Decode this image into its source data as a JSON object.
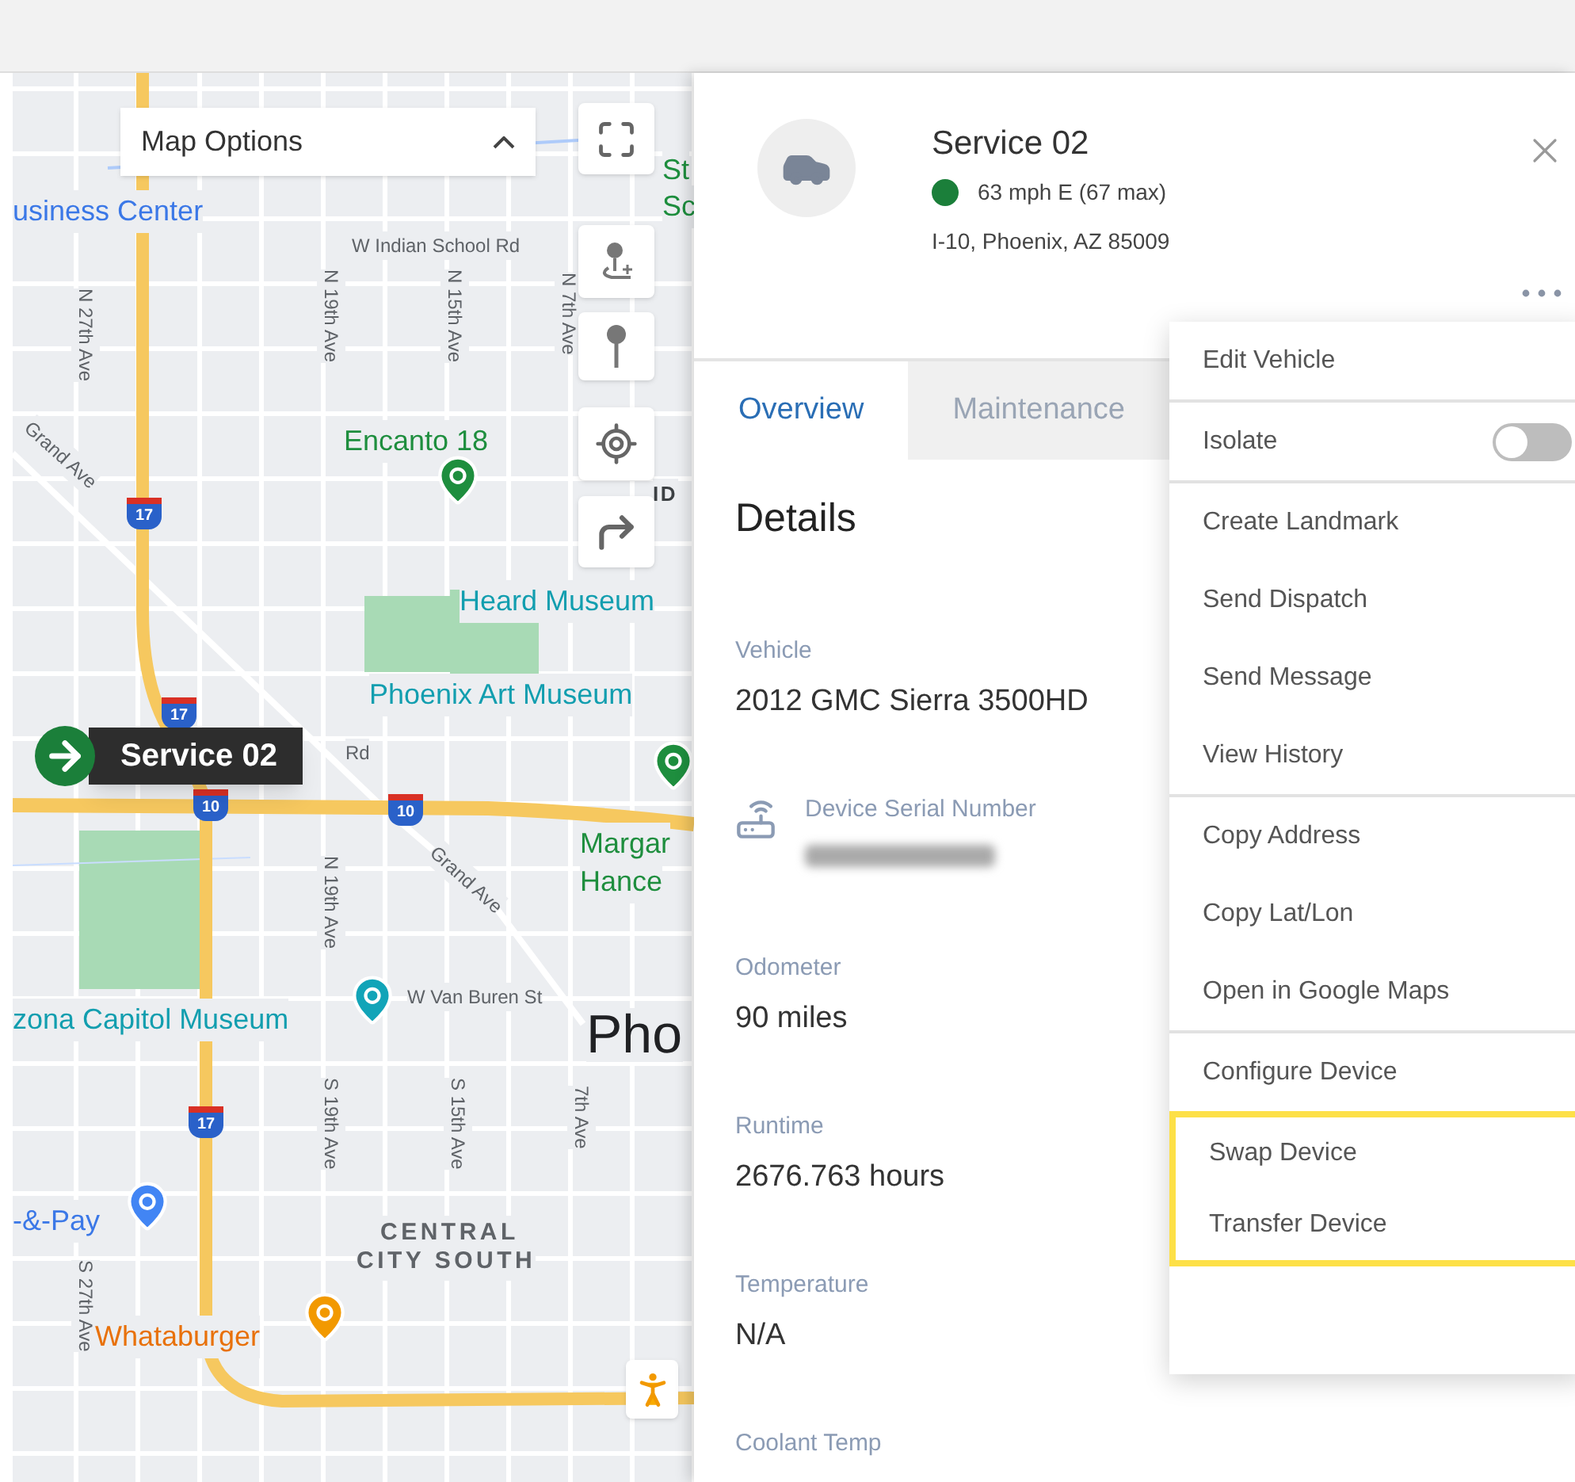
{
  "map": {
    "options_dropdown": {
      "label": "Map Options",
      "expanded": true
    },
    "labels": [
      {
        "text": "usiness Center",
        "kind": "poi-blue"
      },
      {
        "text": "W Indian School Rd",
        "kind": "street"
      },
      {
        "text": "N 27th Ave",
        "kind": "street-vertical"
      },
      {
        "text": "N 19th Ave",
        "kind": "street-vertical"
      },
      {
        "text": "N 15th Ave",
        "kind": "street-vertical"
      },
      {
        "text": "N 7th Ave",
        "kind": "street-vertical"
      },
      {
        "text": "Grand Ave",
        "kind": "street-diagonal"
      },
      {
        "text": "Encanto 18",
        "kind": "poi-green"
      },
      {
        "text": "Heard Museum",
        "kind": "poi-teal"
      },
      {
        "text": "Phoenix Art Museum",
        "kind": "poi-teal"
      },
      {
        "text": "St",
        "kind": "poi-green"
      },
      {
        "text": "Sc",
        "kind": "poi-green"
      },
      {
        "text": "ID",
        "kind": "area"
      },
      {
        "text": "Rd",
        "kind": "street"
      },
      {
        "text": "Margar",
        "kind": "poi-green"
      },
      {
        "text": "Hance",
        "kind": "poi-green"
      },
      {
        "text": "N 19th Ave",
        "kind": "street-vertical"
      },
      {
        "text": "Grand Ave",
        "kind": "street-diagonal"
      },
      {
        "text": "zona Capitol Museum",
        "kind": "poi-teal"
      },
      {
        "text": "W Van Buren St",
        "kind": "street"
      },
      {
        "text": "Pho",
        "kind": "city"
      },
      {
        "text": "S 19th Ave",
        "kind": "street-vertical"
      },
      {
        "text": "S 15th Ave",
        "kind": "street-vertical"
      },
      {
        "text": "7th Ave",
        "kind": "street-vertical"
      },
      {
        "text": "-&-Pay",
        "kind": "poi-blue"
      },
      {
        "text": "CENTRAL",
        "kind": "district"
      },
      {
        "text": "CITY SOUTH",
        "kind": "district"
      },
      {
        "text": "S 27th Ave",
        "kind": "street-vertical"
      },
      {
        "text": "Whataburger",
        "kind": "poi-orange"
      }
    ],
    "shields": [
      {
        "text": "17"
      },
      {
        "text": "17"
      },
      {
        "text": "10"
      },
      {
        "text": "10"
      },
      {
        "text": "17"
      }
    ],
    "vehicle_marker": {
      "label": "Service 02"
    }
  },
  "vehicle_panel": {
    "title": "Service 02",
    "status_dot": {
      "color": "#1b7f3a"
    },
    "speed": "63 mph E (67 max)",
    "address": "I-10, Phoenix, AZ 85009",
    "tabs": [
      {
        "label": "Overview",
        "selected": true
      },
      {
        "label": "Maintenance",
        "selected": false
      }
    ],
    "section_title": "Details",
    "fields": [
      {
        "label": "Vehicle",
        "value": "2012 GMC Sierra 3500HD",
        "kind": "text"
      },
      {
        "label": "Device Serial Number",
        "kind": "redacted"
      },
      {
        "label": "Odometer",
        "value": "90 miles",
        "kind": "text"
      },
      {
        "label": "Runtime",
        "value": "2676.763 hours",
        "kind": "text"
      },
      {
        "label": "Temperature",
        "value": "N/A",
        "kind": "text"
      },
      {
        "label": "Coolant Temp",
        "kind": "cut"
      }
    ],
    "menu": {
      "groups": [
        [
          {
            "label": "Edit Vehicle",
            "kind": "action",
            "highlighted": false
          }
        ],
        [
          {
            "label": "Isolate",
            "kind": "toggle",
            "on": false,
            "highlighted": false
          }
        ],
        [
          {
            "label": "Create Landmark",
            "kind": "action",
            "highlighted": false
          },
          {
            "label": "Send Dispatch",
            "kind": "action",
            "highlighted": false
          },
          {
            "label": "Send Message",
            "kind": "action",
            "highlighted": false
          },
          {
            "label": "View History",
            "kind": "action",
            "highlighted": false
          }
        ],
        [
          {
            "label": "Copy Address",
            "kind": "action",
            "highlighted": false
          },
          {
            "label": "Copy Lat/Lon",
            "kind": "action",
            "highlighted": false
          },
          {
            "label": "Open in Google Maps",
            "kind": "action",
            "highlighted": false
          }
        ],
        [
          {
            "label": "Configure Device",
            "kind": "action",
            "highlighted": false
          },
          {
            "label": "Swap Device",
            "kind": "action",
            "highlighted": true
          },
          {
            "label": "Transfer Device",
            "kind": "action",
            "highlighted": true
          }
        ]
      ]
    }
  }
}
